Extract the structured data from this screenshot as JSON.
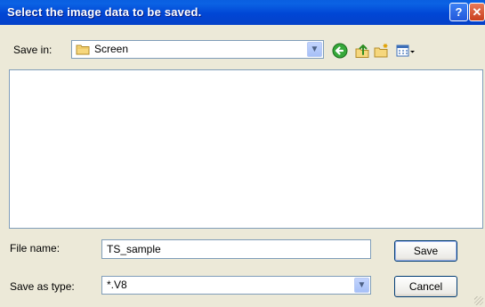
{
  "window": {
    "title": "Select the image data to be saved."
  },
  "titlebar": {
    "help_label": "?",
    "close_label": "✕"
  },
  "save_in": {
    "label": "Save in:",
    "value": "Screen"
  },
  "toolbar": {
    "icons": [
      "back-icon",
      "up-folder-icon",
      "new-folder-icon",
      "view-menu-icon"
    ]
  },
  "file_list": {
    "items": []
  },
  "file_name": {
    "label": "File name:",
    "value": "TS_sample"
  },
  "save_as_type": {
    "label": "Save as type:",
    "value": "*.V8"
  },
  "buttons": {
    "save": "Save",
    "cancel": "Cancel"
  }
}
